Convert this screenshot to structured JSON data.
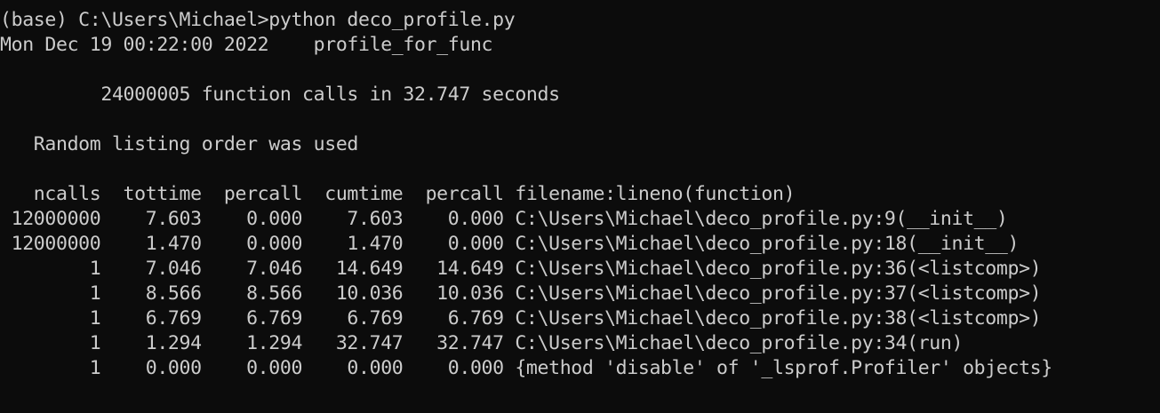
{
  "terminal": {
    "lines": [
      "(base) C:\\Users\\Michael>python deco_profile.py",
      "Mon Dec 19 00:22:00 2022    profile_for_func",
      "",
      "         24000005 function calls in 32.747 seconds",
      "",
      "   Random listing order was used",
      "",
      "   ncalls  tottime  percall  cumtime  percall filename:lineno(function)",
      " 12000000    7.603    0.000    7.603    0.000 C:\\Users\\Michael\\deco_profile.py:9(__init__)",
      " 12000000    1.470    0.000    1.470    0.000 C:\\Users\\Michael\\deco_profile.py:18(__init__)",
      "        1    7.046    7.046   14.649   14.649 C:\\Users\\Michael\\deco_profile.py:36(<listcomp>)",
      "        1    8.566    8.566   10.036   10.036 C:\\Users\\Michael\\deco_profile.py:37(<listcomp>)",
      "        1    6.769    6.769    6.769    6.769 C:\\Users\\Michael\\deco_profile.py:38(<listcomp>)",
      "        1    1.294    1.294   32.747   32.747 C:\\Users\\Michael\\deco_profile.py:34(run)",
      "        1    0.000    0.000    0.000    0.000 {method 'disable' of '_lsprof.Profiler' objects}"
    ]
  },
  "colors": {
    "background": "#0c0c0c",
    "foreground": "#cccccc"
  }
}
